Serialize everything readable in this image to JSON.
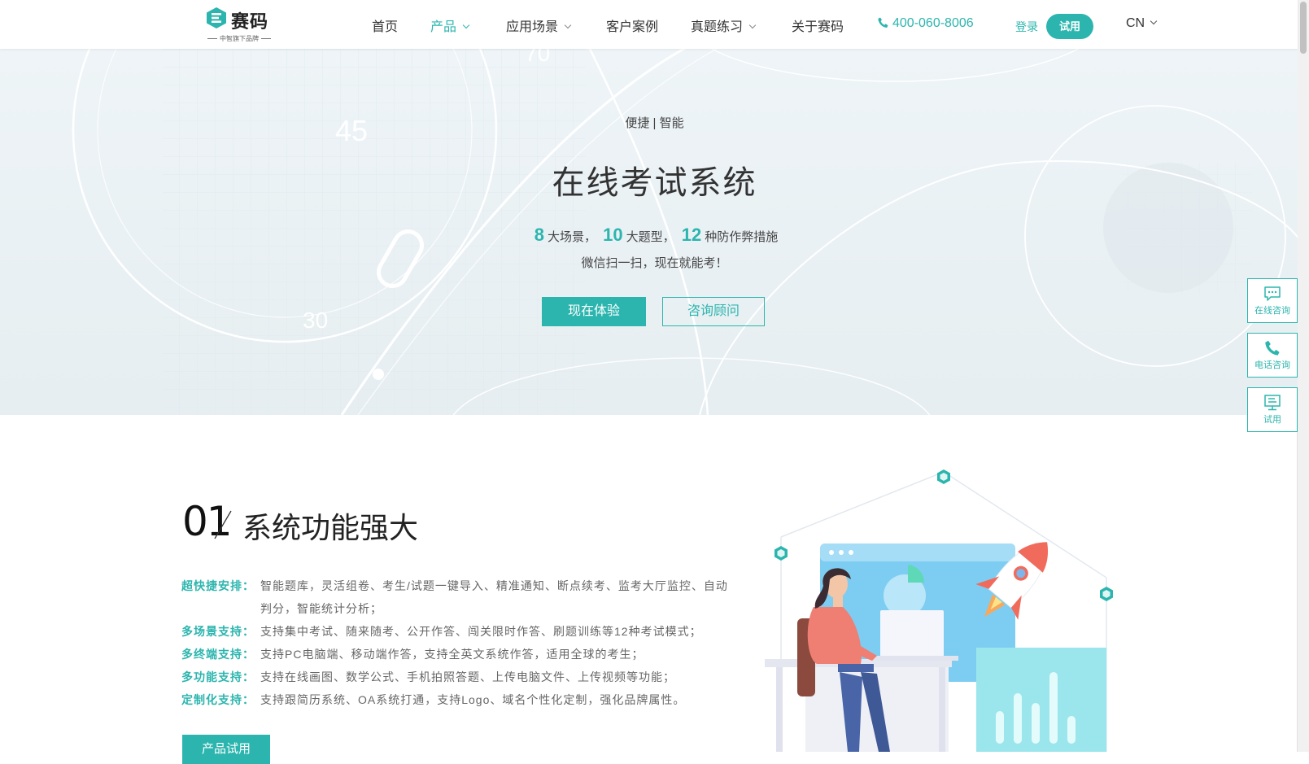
{
  "brand": {
    "name": "赛码",
    "sub": "中智旗下品牌"
  },
  "nav": {
    "home": "首页",
    "product": "产品",
    "scenarios": "应用场景",
    "cases": "客户案例",
    "practice": "真题练习",
    "about": "关于赛码",
    "phone": "400-060-8006",
    "login": "登录",
    "trial": "试用",
    "lang": "CN"
  },
  "hero": {
    "tagline": "便捷 | 智能",
    "title": "在线考试系统",
    "stat1_num": "8",
    "stat1_text": "大场景，",
    "stat2_num": "10",
    "stat2_text": "大题型，",
    "stat3_num": "12",
    "stat3_text": "种防作弊措施",
    "sub": "微信扫一扫，现在就能考！",
    "btn_primary": "现在体验",
    "btn_secondary": "咨询顾问",
    "bg_numbers": [
      "45",
      "30",
      "70"
    ]
  },
  "float": {
    "online": "在线咨询",
    "phone": "电话咨询",
    "trial": "试用"
  },
  "feature": {
    "number": "01",
    "title": "系统功能强大",
    "items": [
      {
        "label": "超快捷安排：",
        "desc": "智能题库，灵活组卷、考生/试题一键导入、精准通知、断点续考、监考大厅监控、自动判分，智能统计分析；"
      },
      {
        "label": "多场景支持：",
        "desc": "支持集中考试、随来随考、公开作答、闯关限时作答、刷题训练等12种考试模式；"
      },
      {
        "label": "多终端支持：",
        "desc": "支持PC电脑端、移动端作答，支持全英文系统作答，适用全球的考生；"
      },
      {
        "label": "多功能支持：",
        "desc": "支持在线画图、数学公式、手机拍照答题、上传电脑文件、上传视频等功能；"
      },
      {
        "label": "定制化支持：",
        "desc": "支持跟简历系统、OA系统打通，支持Logo、域名个性化定制，强化品牌属性。"
      }
    ],
    "button": "产品试用"
  },
  "colors": {
    "accent": "#2cb5ae",
    "hero_bg": "#eaf1f4",
    "rocket": "#f06b5c"
  }
}
